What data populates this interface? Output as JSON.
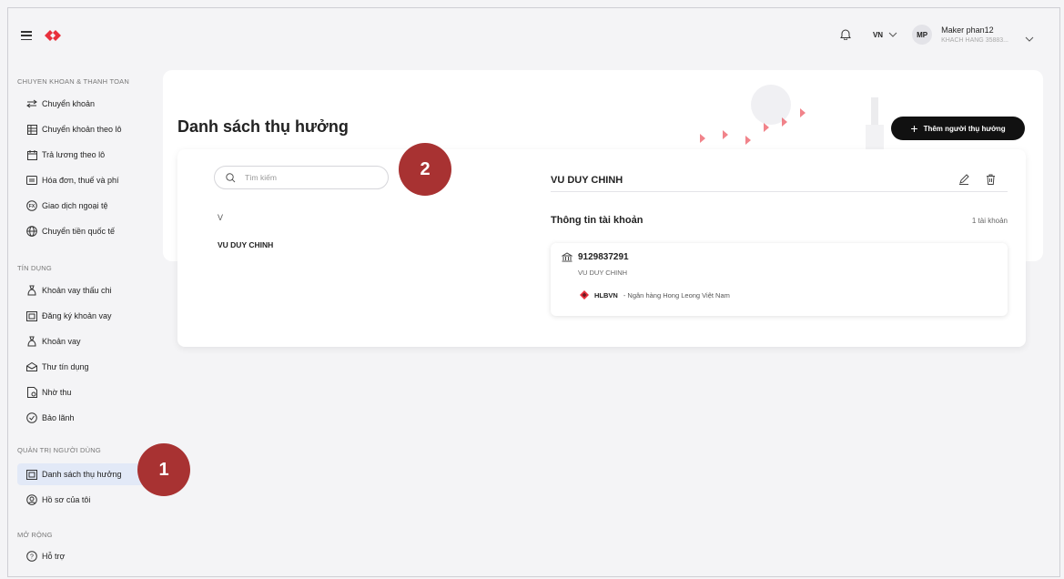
{
  "header": {
    "language": "VN",
    "user_initials": "MP",
    "user_name": "Maker phan12",
    "user_subtitle": "KHACH HANG 35883..."
  },
  "sidebar": {
    "sections": [
      {
        "title": "CHUYEN KHOAN & THANH TOAN"
      },
      {
        "title": "TÍN DỤNG"
      },
      {
        "title": "QUẢN TRỊ NGƯỜI DÙNG"
      },
      {
        "title": "MỞ RỘNG"
      }
    ],
    "items": [
      {
        "label": "Chuyển khoản",
        "icon": "transfer-icon"
      },
      {
        "label": "Chuyển khoản theo lô",
        "icon": "batch-transfer-icon"
      },
      {
        "label": "Trả lương theo lô",
        "icon": "payroll-icon"
      },
      {
        "label": "Hóa đơn, thuế và phí",
        "icon": "bill-icon"
      },
      {
        "label": "Giao dịch ngoại tệ",
        "icon": "fx-icon"
      },
      {
        "label": "Chuyển tiền quốc tế",
        "icon": "globe-icon"
      },
      {
        "label": "Khoản vay thấu chi",
        "icon": "overdraft-icon"
      },
      {
        "label": "Đăng ký khoản vay",
        "icon": "loan-register-icon"
      },
      {
        "label": "Khoản vay",
        "icon": "loan-icon"
      },
      {
        "label": "Thư tín dụng",
        "icon": "letter-credit-icon"
      },
      {
        "label": "Nhờ thu",
        "icon": "collection-icon"
      },
      {
        "label": "Bảo lãnh",
        "icon": "guarantee-icon"
      },
      {
        "label": "Danh sách thụ hưởng",
        "icon": "beneficiary-icon"
      },
      {
        "label": "Hồ sơ của tôi",
        "icon": "profile-icon"
      },
      {
        "label": "Hỗ trợ",
        "icon": "help-icon"
      }
    ]
  },
  "main": {
    "title": "Danh sách thụ hưởng",
    "add_button": "Thêm người thụ hưởng",
    "search_placeholder": "Tìm kiếm",
    "group_letter": "V",
    "list": [
      {
        "name": "VU DUY CHINH"
      }
    ],
    "detail": {
      "name": "VU DUY CHINH",
      "account_info_title": "Thông tin tài khoản",
      "account_count": "1 tài khoản",
      "account": {
        "number": "9129837291",
        "owner": "VU DUY CHINH",
        "bank_code": "HLBVN",
        "bank_name": "- Ngân hàng Hong Leong Việt Nam"
      }
    }
  },
  "markers": [
    "1",
    "2"
  ],
  "colors": {
    "brand": "#e8303c",
    "marker": "#a83232",
    "active_bg": "#e2e9f7"
  }
}
